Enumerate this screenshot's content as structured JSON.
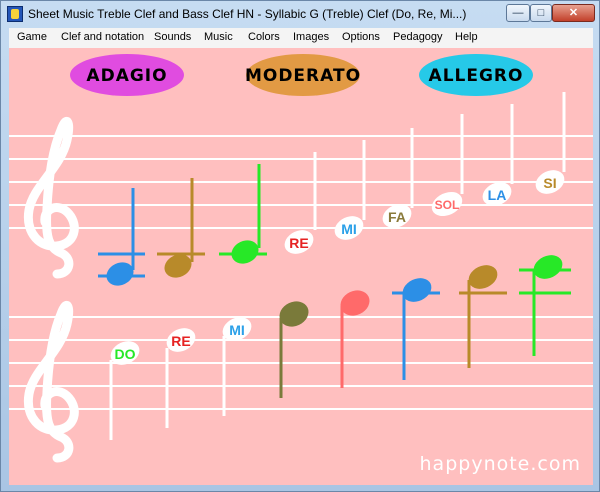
{
  "window": {
    "title": "Sheet Music Treble Clef and Bass Clef HN - Syllabic G (Treble) Clef (Do, Re, Mi...)",
    "controls": {
      "minimize": "—",
      "maximize": "□",
      "close": "✕"
    }
  },
  "menu": [
    "Game",
    "Clef and notation",
    "Sounds",
    "Music",
    "Colors",
    "Images",
    "Options",
    "Pedagogy",
    "Help"
  ],
  "tempo_buttons": [
    {
      "label": "ADAGIO",
      "color": "#e04ce0"
    },
    {
      "label": "MODERATO",
      "color": "#e29a44"
    },
    {
      "label": "ALLEGRO",
      "color": "#26c9e8"
    }
  ],
  "staff_top": {
    "notes": [
      {
        "label": "",
        "color": "#2c8fe6"
      },
      {
        "label": "",
        "color": "#b88a2a"
      },
      {
        "label": "",
        "color": "#27e827"
      },
      {
        "label": "RE",
        "color": "#e62222"
      },
      {
        "label": "MI",
        "color": "#2aa0e8"
      },
      {
        "label": "FA",
        "color": "#8a7a3a"
      },
      {
        "label": "SOL",
        "color": "#ff6a6a"
      },
      {
        "label": "LA",
        "color": "#2c8fe6"
      },
      {
        "label": "SI",
        "color": "#b88a2a"
      }
    ]
  },
  "staff_bottom": {
    "notes": [
      {
        "label": "DO",
        "color": "#27e827"
      },
      {
        "label": "RE",
        "color": "#e62222"
      },
      {
        "label": "MI",
        "color": "#2aa0e8"
      },
      {
        "label": "",
        "color": "#7a7a3a"
      },
      {
        "label": "",
        "color": "#ff6a6a"
      },
      {
        "label": "",
        "color": "#2c8fe6"
      },
      {
        "label": "",
        "color": "#b88a2a"
      },
      {
        "label": "",
        "color": "#27e827"
      }
    ]
  },
  "watermark": "happynote.com"
}
